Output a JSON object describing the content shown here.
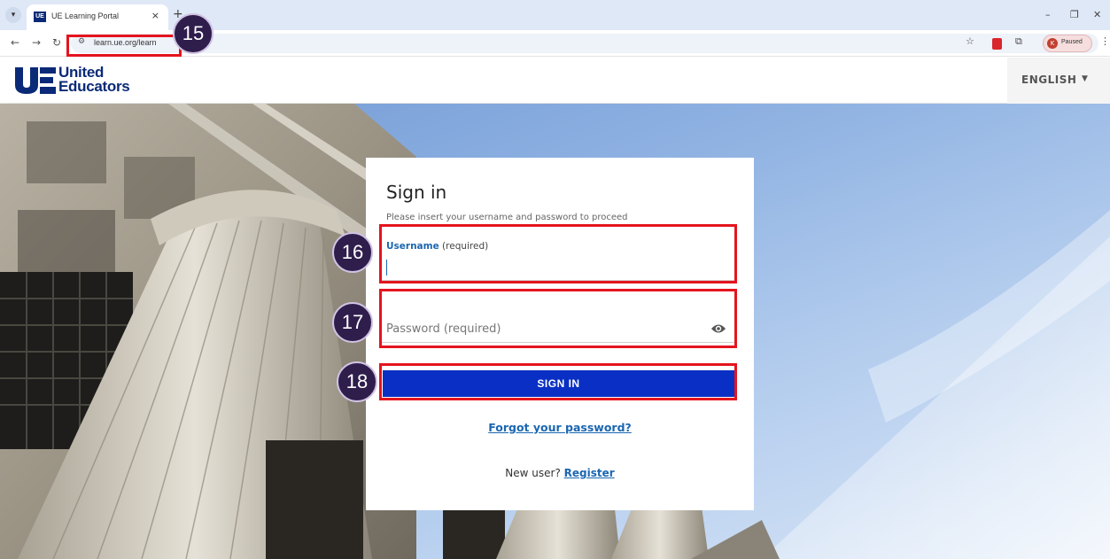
{
  "browser": {
    "tab_title": "UE Learning Portal",
    "tab_favicon_text": "UE",
    "tab_close": "×",
    "new_tab": "+",
    "url": "learn.ue.org/learn",
    "profile_label": "Paused",
    "profile_initial": "K"
  },
  "header": {
    "logo_line1": "United",
    "logo_line2": "Educators",
    "language": "ENGLISH",
    "brand_color": "#0a2a78"
  },
  "signin": {
    "title": "Sign in",
    "subtitle": "Please insert your username and password to proceed",
    "username_label": "Username",
    "username_required": "(required)",
    "password_placeholder": "Password (required)",
    "button_label": "SIGN IN",
    "forgot_link": "Forgot your password?",
    "new_user_text": "New user?",
    "register_link": "Register",
    "accent_color": "#1b66b1",
    "button_color": "#0a2fc4"
  },
  "annotations": {
    "url_step": "15",
    "username_step": "16",
    "password_step": "17",
    "signin_step": "18",
    "highlight_color": "#e4141e"
  }
}
